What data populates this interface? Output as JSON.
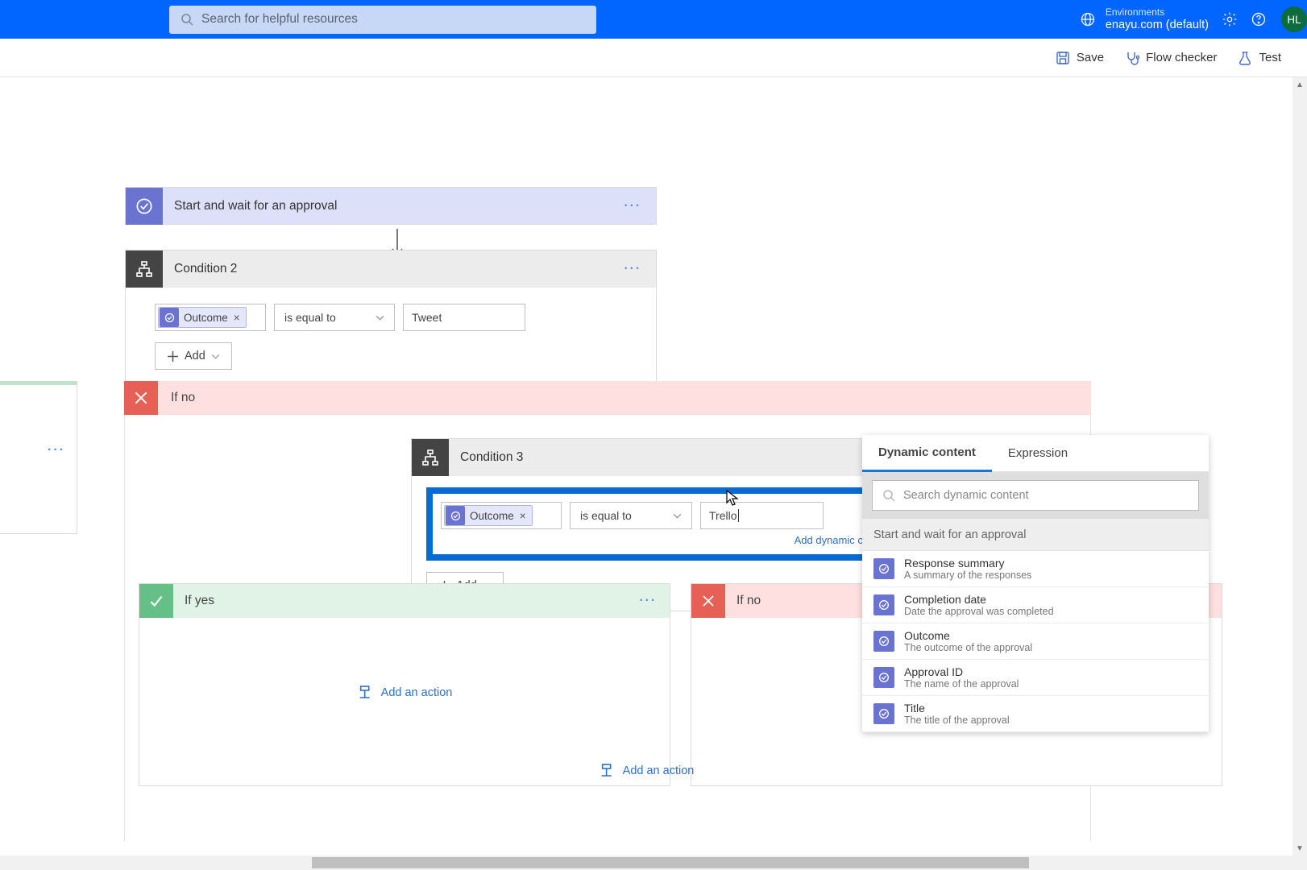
{
  "header": {
    "search_placeholder": "Search for helpful resources",
    "env_label": "Environments",
    "env_name": "enayu.com (default)",
    "avatar": "HL"
  },
  "cmdbar": {
    "save": "Save",
    "checker": "Flow checker",
    "test": "Test"
  },
  "approval_step": {
    "title": "Start and wait for an approval"
  },
  "cond2": {
    "title": "Condition 2",
    "token": "Outcome",
    "operator": "is equal to",
    "value": "Tweet",
    "add": "Add"
  },
  "ifno_big": {
    "title": "If no"
  },
  "cond3": {
    "title": "Condition 3",
    "token": "Outcome",
    "operator": "is equal to",
    "value": "Trello",
    "dyn_link": "Add dynamic content",
    "add": "Add"
  },
  "nested": {
    "yes": "If yes",
    "no": "If no",
    "add_action": "Add an action"
  },
  "panel": {
    "tab_dynamic": "Dynamic content",
    "tab_expression": "Expression",
    "search_placeholder": "Search dynamic content",
    "group": "Start and wait for an approval",
    "items": [
      {
        "t": "Response summary",
        "d": "A summary of the responses"
      },
      {
        "t": "Completion date",
        "d": "Date the approval was completed"
      },
      {
        "t": "Outcome",
        "d": "The outcome of the approval"
      },
      {
        "t": "Approval ID",
        "d": "The name of the approval"
      },
      {
        "t": "Title",
        "d": "The title of the approval"
      }
    ]
  }
}
